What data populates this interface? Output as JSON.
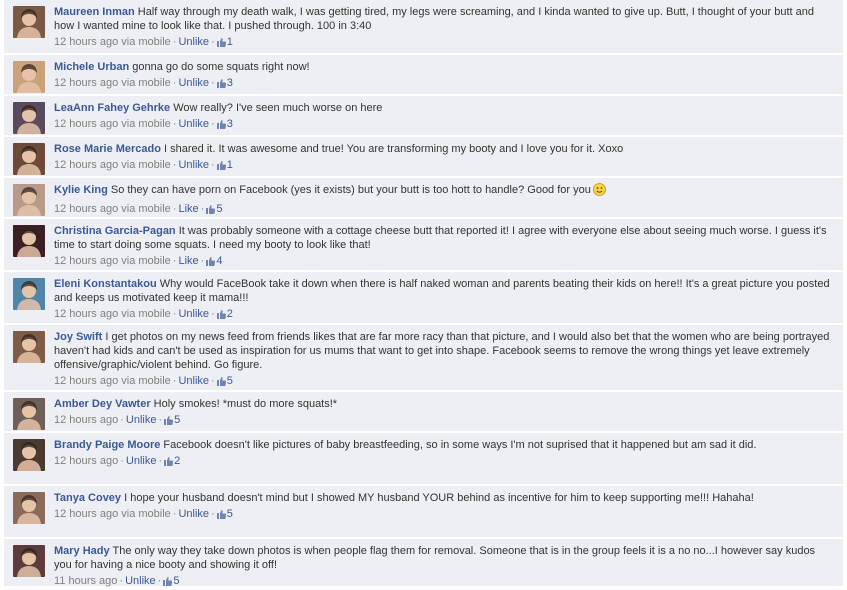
{
  "colors": {
    "link": "#3b5998",
    "meta": "#808080",
    "row_bg": "#edeff4"
  },
  "comments": [
    {
      "author": "Maureen Inman",
      "text": "Half way through my death walk, I was getting tired, my legs were screaming, and I kinda wanted to give up. Butt, I thought of your butt and how I wanted mine to look like that. I pushed through. 100 in 3:40",
      "time": "12 hours ago via mobile",
      "action": "Unlike",
      "likes": "1",
      "avatar_color": "#7a5a44"
    },
    {
      "author": "Michele Urban",
      "text": "gonna go do some squats right now!",
      "time": "12 hours ago via mobile",
      "action": "Unlike",
      "likes": "3",
      "avatar_color": "#c9a27a"
    },
    {
      "author": "LeaAnn Fahey Gehrke",
      "text": "Wow really? I've seen much worse on here",
      "time": "12 hours ago via mobile",
      "action": "Unlike",
      "likes": "3",
      "avatar_color": "#5a4a5e"
    },
    {
      "author": "Rose Marie Mercado",
      "text": "I shared it. It was awesome and true! You are transforming my booty and I love you for it. Xoxo",
      "time": "12 hours ago via mobile",
      "action": "Unlike",
      "likes": "1",
      "avatar_color": "#6b4a3a"
    },
    {
      "author": "Kylie King",
      "text": "So they can have porn on Facebook (yes it exists) but your butt is too hott to handle? Good for you",
      "time": "12 hours ago via mobile",
      "action": "Like",
      "likes": "5",
      "avatar_color": "#b79a8a"
    },
    {
      "author": "Christina Garcia-Pagan",
      "text": "It was probably someone with a cottage cheese butt that reported it! I agree with everyone else about seeing much worse. I guess it's time to start doing some squats. I need my booty to look like that!",
      "time": "12 hours ago via mobile",
      "action": "Like",
      "likes": "4",
      "avatar_color": "#3c1f24"
    },
    {
      "author": "Eleni Konstantakou",
      "text": "Why would FaceBook take it down when there is half naked woman and parents beating their kids on here!! It's a great picture you posted and keeps us motivated keep it mama!!!",
      "time": "12 hours ago via mobile",
      "action": "Unlike",
      "likes": "2",
      "avatar_color": "#4f86a8"
    },
    {
      "author": "Joy Swift",
      "text": "I get photos on my news feed from friends likes that are far more racy than that picture, and I would also bet that the women who are being portrayed haven't had kids and can't be used as inspiration for us mums that want to get into shape. Facebook seems to remove the wrong things yet leave extremely offensive/graphic/violent behind. Go figure.",
      "time": "12 hours ago via mobile",
      "action": "Unlike",
      "likes": "5",
      "avatar_color": "#7d5c48"
    },
    {
      "author": "Amber Dey Vawter",
      "text": "Holy smokes! *must do more squats!*",
      "time": "12 hours ago",
      "action": "Unlike",
      "likes": "5",
      "avatar_color": "#6e5f58"
    },
    {
      "author": "Brandy Paige Moore",
      "text": "Facebook doesn't like pictures of baby breastfeeding, so in some ways I'm not suprised that it happened but am sad it did.",
      "time": "12 hours ago",
      "action": "Unlike",
      "likes": "2",
      "avatar_color": "#4a3a30"
    },
    {
      "author": "Tanya Covey",
      "text": "I hope your husband doesn't mind but I showed MY husband YOUR behind as incentive for him to keep supporting me!!! Hahaha!",
      "time": "12 hours ago via mobile",
      "action": "Unlike",
      "likes": "5",
      "avatar_color": "#8a6a5a"
    },
    {
      "author": "Mary Hady",
      "text": "The only way they take down photos is when people flag them for removal. Someone that is in the group feels it is a no no...I however say kudos you for having a nice booty and showing it off!",
      "time": "11 hours ago",
      "action": "Unlike",
      "likes": "5",
      "avatar_color": "#5b3b3b"
    }
  ]
}
